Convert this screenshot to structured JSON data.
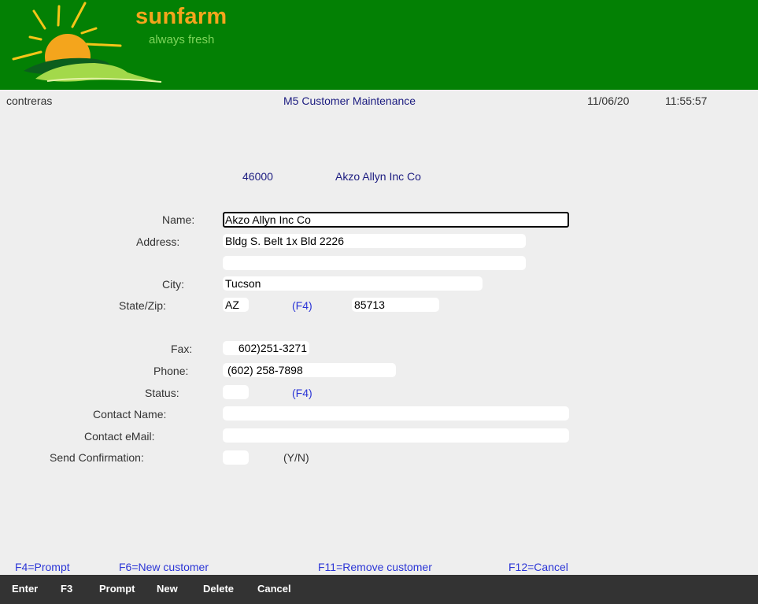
{
  "header": {
    "brand": "sunfarm",
    "tagline": "always fresh",
    "colors": {
      "background": "#038004",
      "brand": "#f4a51c",
      "tagline": "#7fd55c"
    }
  },
  "status_bar": {
    "user": "contreras",
    "title": "M5 Customer Maintenance",
    "date": "11/06/20",
    "time": "11:55:57"
  },
  "customer": {
    "number": "46000",
    "name": "Akzo Allyn Inc Co"
  },
  "form": {
    "name_label": "Name:",
    "name_value": "Akzo Allyn Inc Co",
    "address_label": "Address:",
    "address1_value": "Bldg S. Belt 1x Bld 2226",
    "address2_value": "",
    "city_label": "City:",
    "city_value": "Tucson",
    "statezip_label": "State/Zip:",
    "state_value": "AZ",
    "state_prompt": "(F4)",
    "zip_value": "85713",
    "fax_label": "Fax:",
    "fax_value": "602)251-3271",
    "phone_label": "Phone:",
    "phone_value": "(602) 258-7898",
    "status_label": "Status:",
    "status_value": "",
    "status_prompt": "(F4)",
    "contact_name_label": "Contact Name:",
    "contact_name_value": "",
    "contact_email_label": "Contact eMail:",
    "contact_email_value": "",
    "send_confirmation_label": "Send Confirmation:",
    "send_confirmation_value": "",
    "send_confirmation_hint": "(Y/N)"
  },
  "function_keys": {
    "f4": "F4=Prompt",
    "f6": "F6=New customer",
    "f11": "F11=Remove customer",
    "f12": "F12=Cancel"
  },
  "buttons": {
    "enter": "Enter",
    "f3": "F3",
    "prompt": "Prompt",
    "new": "New",
    "delete": "Delete",
    "cancel": "Cancel"
  }
}
